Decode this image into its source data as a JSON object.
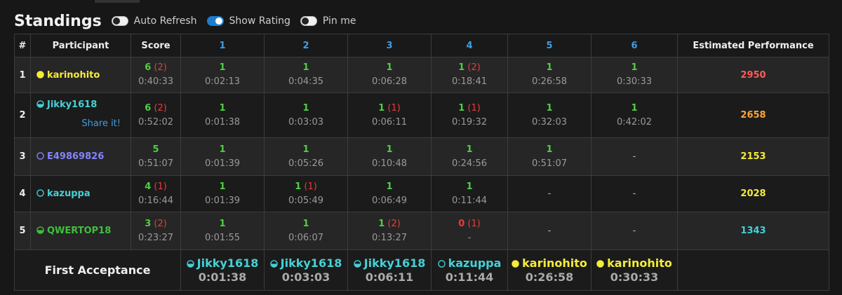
{
  "header": {
    "title": "Standings",
    "toggles": [
      {
        "label": "Auto Refresh",
        "on": false
      },
      {
        "label": "Show Rating",
        "on": true
      },
      {
        "label": "Pin me",
        "on": false
      }
    ]
  },
  "columns": {
    "rank": "#",
    "participant": "Participant",
    "score": "Score",
    "problems": [
      "1",
      "2",
      "3",
      "4",
      "5",
      "6"
    ],
    "performance": "Estimated Performance"
  },
  "rows": [
    {
      "rank": "1",
      "name": "karinohito",
      "color": "#f5ec3c",
      "fill": 1.0,
      "share": "",
      "score": {
        "points": "6",
        "penalty": "(2)",
        "time": "0:40:33"
      },
      "problems": [
        {
          "ac": "1",
          "wa": "",
          "time": "0:02:13"
        },
        {
          "ac": "1",
          "wa": "",
          "time": "0:04:35"
        },
        {
          "ac": "1",
          "wa": "",
          "time": "0:06:28"
        },
        {
          "ac": "1",
          "wa": "(2)",
          "time": "0:18:41"
        },
        {
          "ac": "1",
          "wa": "",
          "time": "0:26:58"
        },
        {
          "ac": "1",
          "wa": "",
          "time": "0:30:33"
        }
      ],
      "performance": "2950",
      "perf_color": "#ff5b5b"
    },
    {
      "rank": "2",
      "name": "Jikky1618",
      "color": "#45d1d6",
      "fill": 0.5,
      "share": "Share it!",
      "score": {
        "points": "6",
        "penalty": "(2)",
        "time": "0:52:02"
      },
      "problems": [
        {
          "ac": "1",
          "wa": "",
          "time": "0:01:38"
        },
        {
          "ac": "1",
          "wa": "",
          "time": "0:03:03"
        },
        {
          "ac": "1",
          "wa": "(1)",
          "time": "0:06:11"
        },
        {
          "ac": "1",
          "wa": "(1)",
          "time": "0:19:32"
        },
        {
          "ac": "1",
          "wa": "",
          "time": "0:32:03"
        },
        {
          "ac": "1",
          "wa": "",
          "time": "0:42:02"
        }
      ],
      "performance": "2658",
      "perf_color": "#ffa43a"
    },
    {
      "rank": "3",
      "name": "E49869826",
      "color": "#8484ff",
      "fill": 0.0,
      "share": "",
      "score": {
        "points": "5",
        "penalty": "",
        "time": "0:51:07"
      },
      "problems": [
        {
          "ac": "1",
          "wa": "",
          "time": "0:01:39"
        },
        {
          "ac": "1",
          "wa": "",
          "time": "0:05:26"
        },
        {
          "ac": "1",
          "wa": "",
          "time": "0:10:48"
        },
        {
          "ac": "1",
          "wa": "",
          "time": "0:24:56"
        },
        {
          "ac": "1",
          "wa": "",
          "time": "0:51:07"
        },
        {
          "dash": "-"
        }
      ],
      "performance": "2153",
      "perf_color": "#f5ec3c"
    },
    {
      "rank": "4",
      "name": "kazuppa",
      "color": "#45d1d6",
      "fill": 0.15,
      "share": "",
      "score": {
        "points": "4",
        "penalty": "(1)",
        "time": "0:16:44"
      },
      "problems": [
        {
          "ac": "1",
          "wa": "",
          "time": "0:01:39"
        },
        {
          "ac": "1",
          "wa": "(1)",
          "time": "0:05:49"
        },
        {
          "ac": "1",
          "wa": "",
          "time": "0:06:49"
        },
        {
          "ac": "1",
          "wa": "",
          "time": "0:11:44"
        },
        {
          "dash": "-"
        },
        {
          "dash": "-"
        }
      ],
      "performance": "2028",
      "perf_color": "#f5ec3c"
    },
    {
      "rank": "5",
      "name": "QWERTOP18",
      "color": "#3fbf3f",
      "fill": 0.5,
      "share": "",
      "score": {
        "points": "3",
        "penalty": "(2)",
        "time": "0:23:27"
      },
      "problems": [
        {
          "ac": "1",
          "wa": "",
          "time": "0:01:55"
        },
        {
          "ac": "1",
          "wa": "",
          "time": "0:06:07"
        },
        {
          "ac": "1",
          "wa": "(2)",
          "time": "0:13:27"
        },
        {
          "ac": "0",
          "wa": "(1)",
          "time": "-",
          "zero": true
        },
        {
          "dash": "-"
        },
        {
          "dash": "-"
        }
      ],
      "performance": "1343",
      "perf_color": "#45d1d6"
    }
  ],
  "first_acceptance": {
    "label": "First Acceptance",
    "entries": [
      {
        "name": "Jikky1618",
        "time": "0:01:38",
        "color": "#45d1d6",
        "fill": 0.5
      },
      {
        "name": "Jikky1618",
        "time": "0:03:03",
        "color": "#45d1d6",
        "fill": 0.5
      },
      {
        "name": "Jikky1618",
        "time": "0:06:11",
        "color": "#45d1d6",
        "fill": 0.5
      },
      {
        "name": "kazuppa",
        "time": "0:11:44",
        "color": "#45d1d6",
        "fill": 0.15
      },
      {
        "name": "karinohito",
        "time": "0:26:58",
        "color": "#f5ec3c",
        "fill": 1.0
      },
      {
        "name": "karinohito",
        "time": "0:30:33",
        "color": "#f5ec3c",
        "fill": 1.0
      }
    ]
  }
}
